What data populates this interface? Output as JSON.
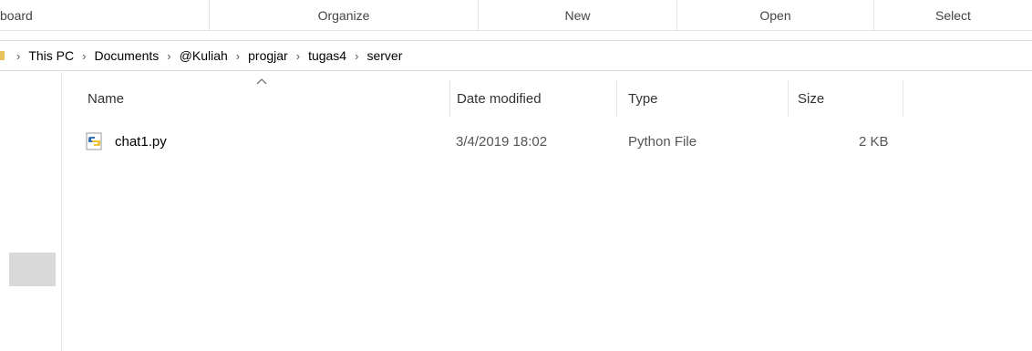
{
  "ribbon": {
    "groups": [
      "board",
      "Organize",
      "New",
      "Open",
      "Select"
    ]
  },
  "address_bar": {
    "crumbs": [
      "This PC",
      "Documents",
      "@Kuliah",
      "progjar",
      "tugas4",
      "server"
    ],
    "separator": "›"
  },
  "columns": {
    "name": "Name",
    "date_modified": "Date modified",
    "type": "Type",
    "size": "Size"
  },
  "sort_indicator": "caret-up-icon",
  "files": [
    {
      "name": "chat1.py",
      "date_modified": "3/4/2019 18:02",
      "type": "Python File",
      "size": "2 KB",
      "icon": "python-file-icon"
    }
  ],
  "colors": {
    "python_blue": "#3a6fb0",
    "python_yellow": "#f2c43a",
    "folder_yellow": "#e8c15a",
    "nav_selected": "#d9d9d9"
  }
}
